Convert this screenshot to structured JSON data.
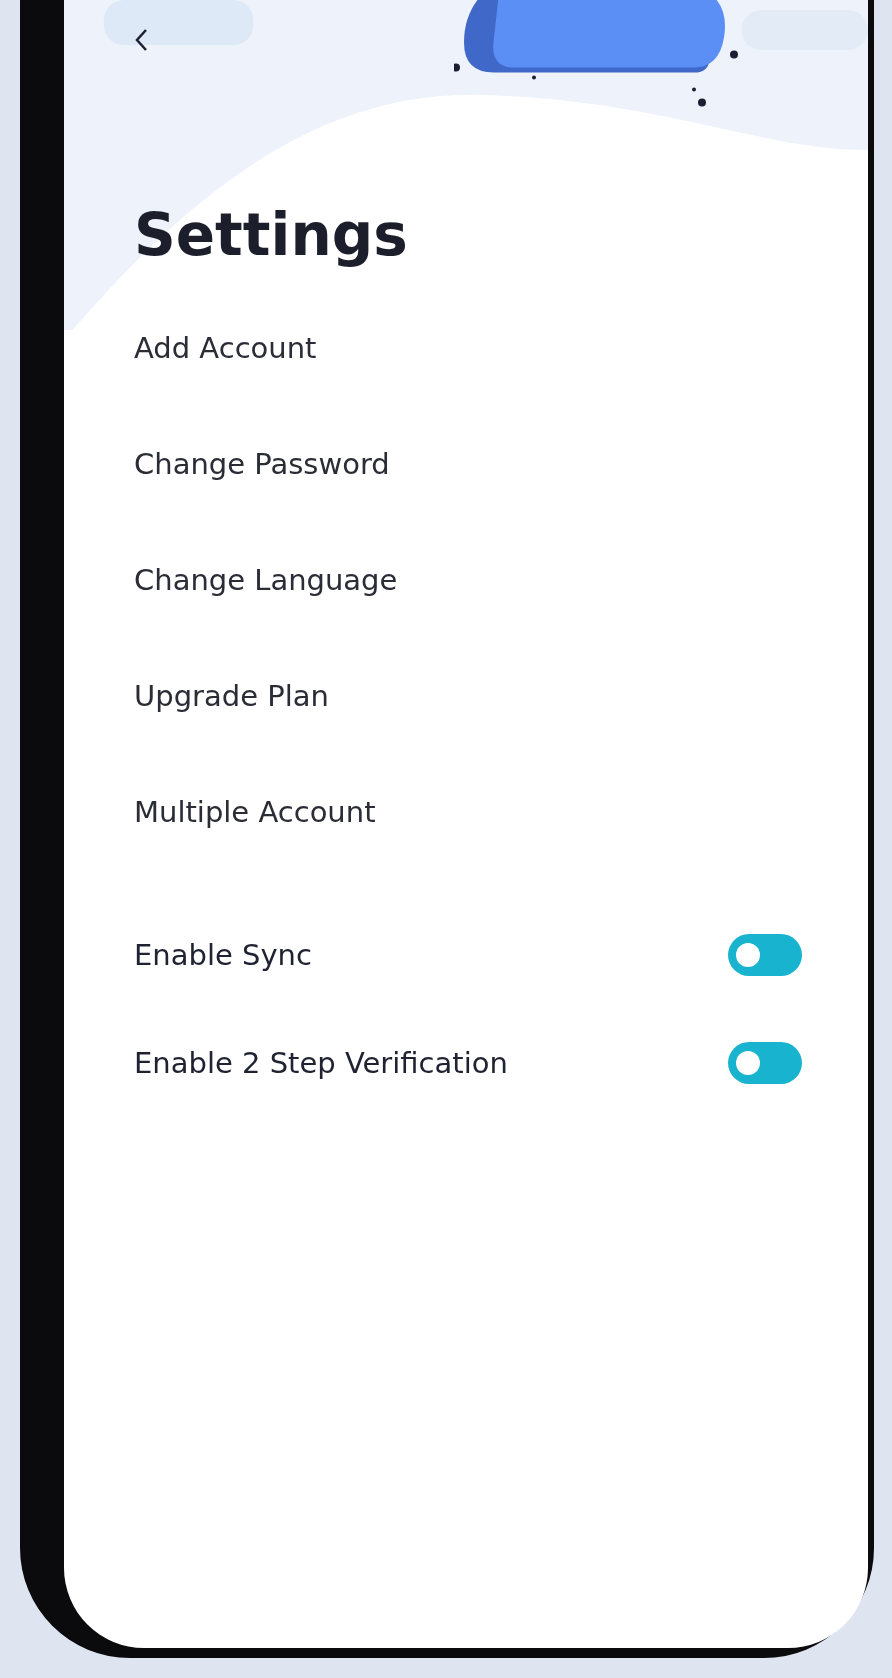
{
  "screen": {
    "title": "Settings"
  },
  "menu_items": [
    {
      "label": "Add Account"
    },
    {
      "label": "Change Password"
    },
    {
      "label": "Change Language"
    },
    {
      "label": "Upgrade Plan"
    },
    {
      "label": "Multiple Account"
    }
  ],
  "toggles": [
    {
      "label": "Enable Sync",
      "on": true
    },
    {
      "label": "Enable 2 Step Verification",
      "on": true
    }
  ]
}
